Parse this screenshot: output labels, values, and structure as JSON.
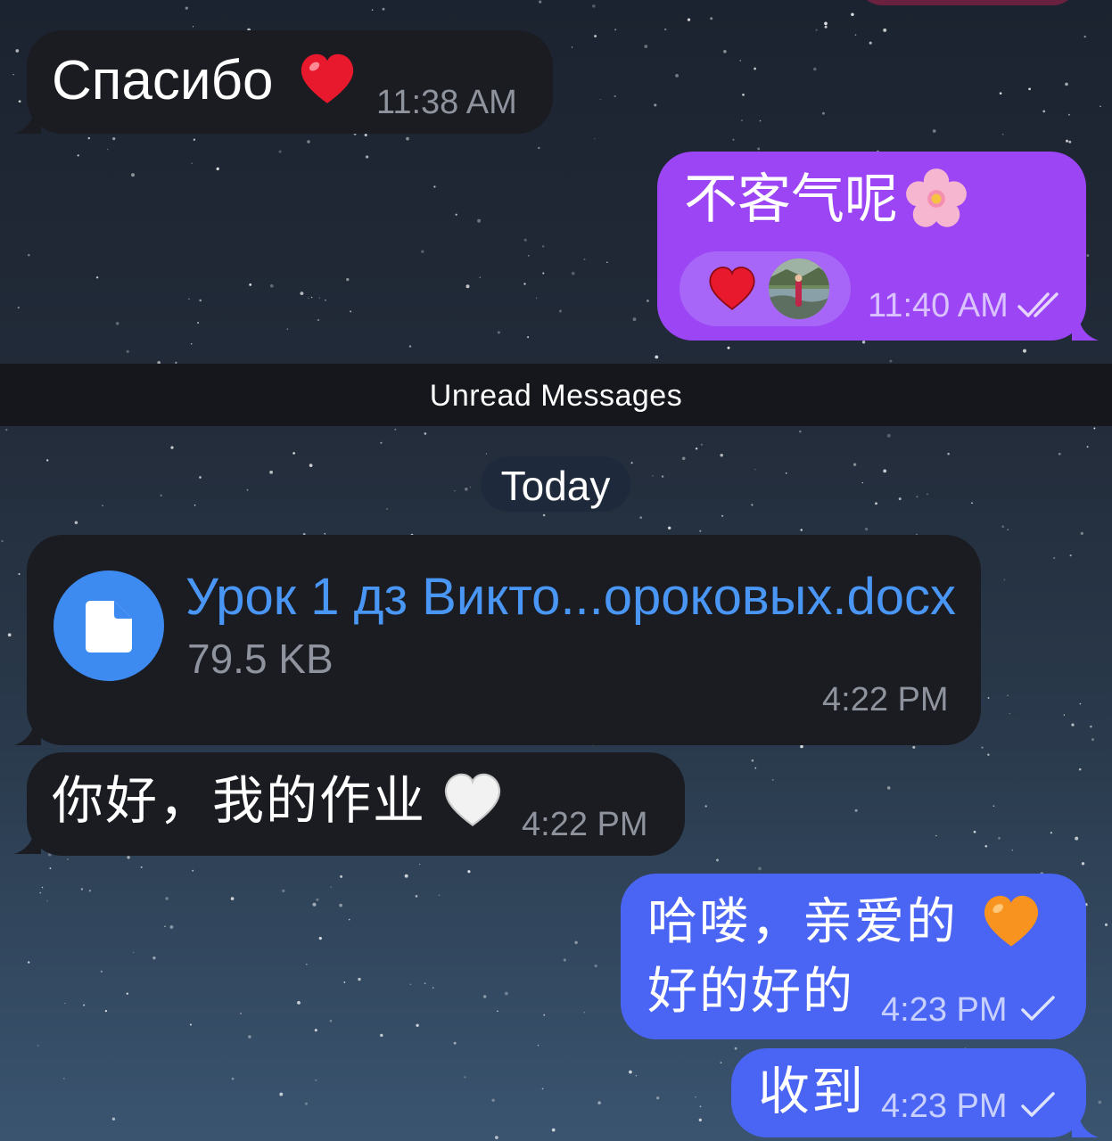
{
  "messages": [
    {
      "id": "m1",
      "direction": "incoming",
      "text": "Спасибо",
      "emoji": "red-heart",
      "time": "11:38 AM"
    },
    {
      "id": "m2",
      "direction": "outgoing",
      "text": "不客气呢",
      "emoji": "cherry-blossom",
      "time": "11:40 AM",
      "status": "read",
      "reaction": "red-heart"
    },
    {
      "id": "m4",
      "direction": "incoming",
      "text": "你好，我的作业",
      "emoji": "white-heart",
      "time": "4:22 PM"
    },
    {
      "id": "m5",
      "direction": "outgoing",
      "line1": "哈喽，亲爱的",
      "line2": "好的好的",
      "emoji": "orange-heart",
      "time": "4:23 PM",
      "status": "sent"
    },
    {
      "id": "m6",
      "direction": "outgoing",
      "text": "收到",
      "time": "4:23 PM",
      "status": "sent"
    }
  ],
  "file_message": {
    "file_name": "Урок 1 дз Викто...ороковых.docx",
    "file_size": "79.5 KB",
    "time": "4:22 PM",
    "icon": "document-icon"
  },
  "unread_separator": "Unread Messages",
  "date_header": "Today",
  "colors": {
    "incoming_bubble": "#1a1c22",
    "outgoing_purple": "#9b45f5",
    "outgoing_blue": "#4a64f4",
    "file_link": "#4a96f5",
    "file_icon": "#3d8af0"
  }
}
